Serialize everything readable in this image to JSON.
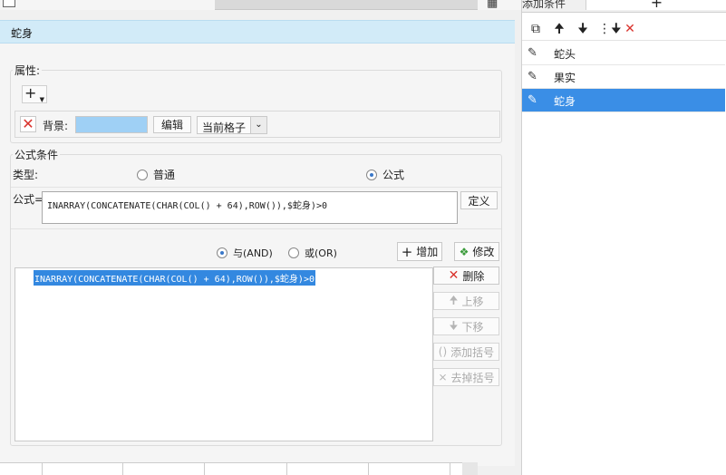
{
  "dialog": {
    "title": "蛇身",
    "properties_group": "属性:",
    "background_label": "背景:",
    "edit_button": "编辑",
    "scope_select": "当前格子",
    "formula_group": "公式条件",
    "type_label": "类型:",
    "type_normal": "普通",
    "type_formula": "公式",
    "formula_label": "公式=",
    "formula_value": "INARRAY(CONCATENATE(CHAR(COL() + 64),ROW()),$蛇身)>0",
    "define_button": "定义",
    "logic_and": "与(AND)",
    "logic_or": "或(OR)",
    "add_button": "增加",
    "modify_button": "修改",
    "condition_list": [
      "INARRAY(CONCATENATE(CHAR(COL() + 64),ROW()),$蛇身)>0"
    ],
    "delete_button": "删除",
    "move_up_button": "上移",
    "move_down_button": "下移",
    "add_bracket_button": "添加括号",
    "remove_bracket_button": "去掉括号"
  },
  "right_panel": {
    "title": "添加条件",
    "add_symbol": "+",
    "conditions": [
      {
        "label": "蛇头",
        "selected": false
      },
      {
        "label": "果实",
        "selected": false
      },
      {
        "label": "蛇身",
        "selected": true
      }
    ]
  },
  "colors": {
    "title_bar": "#d2ebf8",
    "background_swatch": "#9fd0f5",
    "selection": "#3a8ee6",
    "delete_red": "#d9322c"
  }
}
